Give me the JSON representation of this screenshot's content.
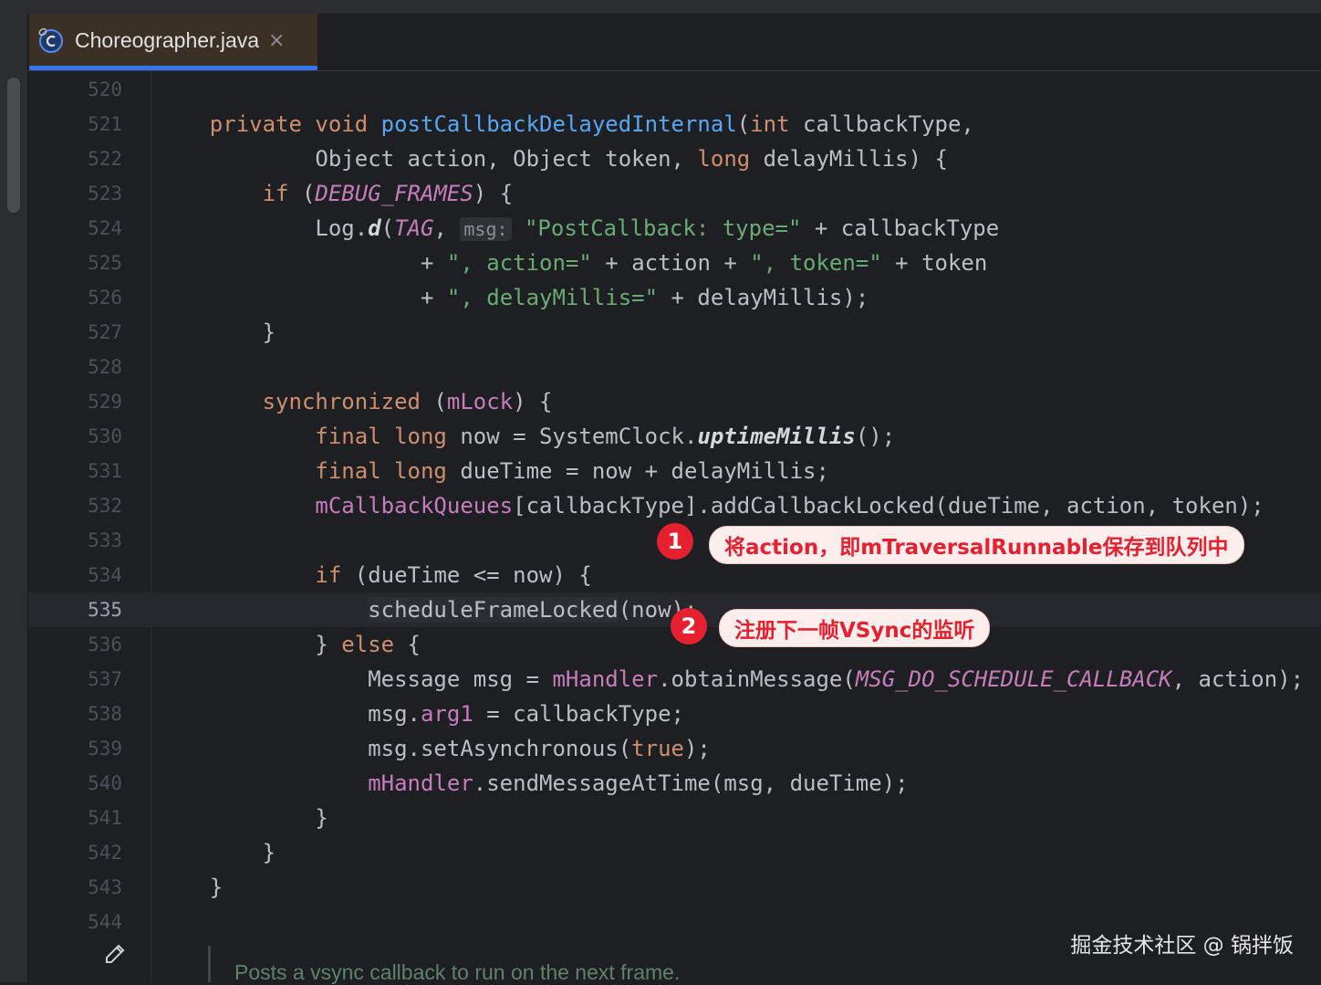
{
  "tab": {
    "label": "Choreographer.java",
    "close": "×",
    "icon": "java-class-icon"
  },
  "colors": {
    "keyword": "#cf8e6d",
    "method": "#56a8f5",
    "field": "#c77dbb",
    "string": "#6aab73",
    "text": "#bcbec4",
    "accent": "#3574f0",
    "annotation": "#e5202f"
  },
  "current_line": 535,
  "lines": [
    {
      "n": "520",
      "t": []
    },
    {
      "n": "521",
      "t": [
        [
          "    ",
          ""
        ],
        [
          "private void ",
          "kw"
        ],
        [
          "postCallbackDelayedInternal",
          "fn"
        ],
        [
          "(",
          ""
        ],
        [
          "int ",
          "kw"
        ],
        [
          "callbackType,",
          ""
        ]
      ]
    },
    {
      "n": "522",
      "t": [
        [
          "            Object action, Object token, ",
          ""
        ],
        [
          "long ",
          "kw"
        ],
        [
          "delayMillis) {",
          ""
        ]
      ]
    },
    {
      "n": "523",
      "t": [
        [
          "        ",
          ""
        ],
        [
          "if ",
          "kw"
        ],
        [
          "(",
          ""
        ],
        [
          "DEBUG_FRAMES",
          "cs"
        ],
        [
          ") {",
          ""
        ]
      ]
    },
    {
      "n": "524",
      "t": [
        [
          "            Log.",
          ""
        ],
        [
          "d",
          "sm"
        ],
        [
          "(",
          ""
        ],
        [
          "TAG",
          "cs"
        ],
        [
          ", ",
          ""
        ],
        [
          "msg:",
          "hint"
        ],
        [
          " ",
          ""
        ],
        [
          "\"PostCallback: type=\"",
          "st"
        ],
        [
          " + callbackType",
          ""
        ]
      ]
    },
    {
      "n": "525",
      "t": [
        [
          "                    + ",
          ""
        ],
        [
          "\", action=\"",
          "st"
        ],
        [
          " + action + ",
          ""
        ],
        [
          "\", token=\"",
          "st"
        ],
        [
          " + token",
          ""
        ]
      ]
    },
    {
      "n": "526",
      "t": [
        [
          "                    + ",
          ""
        ],
        [
          "\", delayMillis=\"",
          "st"
        ],
        [
          " + delayMillis);",
          ""
        ]
      ]
    },
    {
      "n": "527",
      "t": [
        [
          "        }",
          ""
        ]
      ]
    },
    {
      "n": "528",
      "t": []
    },
    {
      "n": "529",
      "t": [
        [
          "        ",
          ""
        ],
        [
          "synchronized ",
          "kw"
        ],
        [
          "(",
          ""
        ],
        [
          "mLock",
          "fd"
        ],
        [
          ") {",
          ""
        ]
      ]
    },
    {
      "n": "530",
      "t": [
        [
          "            ",
          ""
        ],
        [
          "final long ",
          "kw"
        ],
        [
          "now = SystemClock.",
          ""
        ],
        [
          "uptimeMillis",
          "sm"
        ],
        [
          "();",
          ""
        ]
      ]
    },
    {
      "n": "531",
      "t": [
        [
          "            ",
          ""
        ],
        [
          "final long ",
          "kw"
        ],
        [
          "dueTime = now + delayMillis;",
          ""
        ]
      ]
    },
    {
      "n": "532",
      "t": [
        [
          "            ",
          ""
        ],
        [
          "mCallbackQueues",
          "fd"
        ],
        [
          "[callbackType].addCallbackLocked(dueTime, action, token);",
          ""
        ]
      ]
    },
    {
      "n": "533",
      "t": []
    },
    {
      "n": "534",
      "t": [
        [
          "            ",
          ""
        ],
        [
          "if ",
          "kw"
        ],
        [
          "(dueTime <= now) {",
          ""
        ]
      ]
    },
    {
      "n": "535",
      "t": [
        [
          "                ",
          ""
        ],
        [
          "scheduleFrameLocked",
          "hl"
        ],
        [
          "(now);",
          ""
        ]
      ]
    },
    {
      "n": "536",
      "t": [
        [
          "            } ",
          ""
        ],
        [
          "else ",
          "kw"
        ],
        [
          "{",
          ""
        ]
      ]
    },
    {
      "n": "537",
      "t": [
        [
          "                Message msg = ",
          ""
        ],
        [
          "mHandler",
          "fd"
        ],
        [
          ".obtainMessage(",
          ""
        ],
        [
          "MSG_DO_SCHEDULE_CALLBACK",
          "cs"
        ],
        [
          ", action);",
          ""
        ]
      ]
    },
    {
      "n": "538",
      "t": [
        [
          "                msg.",
          ""
        ],
        [
          "arg1",
          "fd"
        ],
        [
          " = callbackType;",
          ""
        ]
      ]
    },
    {
      "n": "539",
      "t": [
        [
          "                msg.setAsynchronous(",
          ""
        ],
        [
          "true",
          "kw"
        ],
        [
          ");",
          ""
        ]
      ]
    },
    {
      "n": "540",
      "t": [
        [
          "                ",
          ""
        ],
        [
          "mHandler",
          "fd"
        ],
        [
          ".sendMessageAtTime(msg, dueTime);",
          ""
        ]
      ]
    },
    {
      "n": "541",
      "t": [
        [
          "            }",
          ""
        ]
      ]
    },
    {
      "n": "542",
      "t": [
        [
          "        }",
          ""
        ]
      ]
    },
    {
      "n": "543",
      "t": [
        [
          "    }",
          ""
        ]
      ]
    },
    {
      "n": "544",
      "t": []
    }
  ],
  "doc_comment": "Posts a vsync callback to run on the next frame.",
  "annotations": [
    {
      "num": "1",
      "text": "将action，即mTraversalRunnable保存到队列中"
    },
    {
      "num": "2",
      "text": "注册下一帧VSync的监听"
    }
  ],
  "watermark": "掘金技术社区 @ 锅拌饭"
}
